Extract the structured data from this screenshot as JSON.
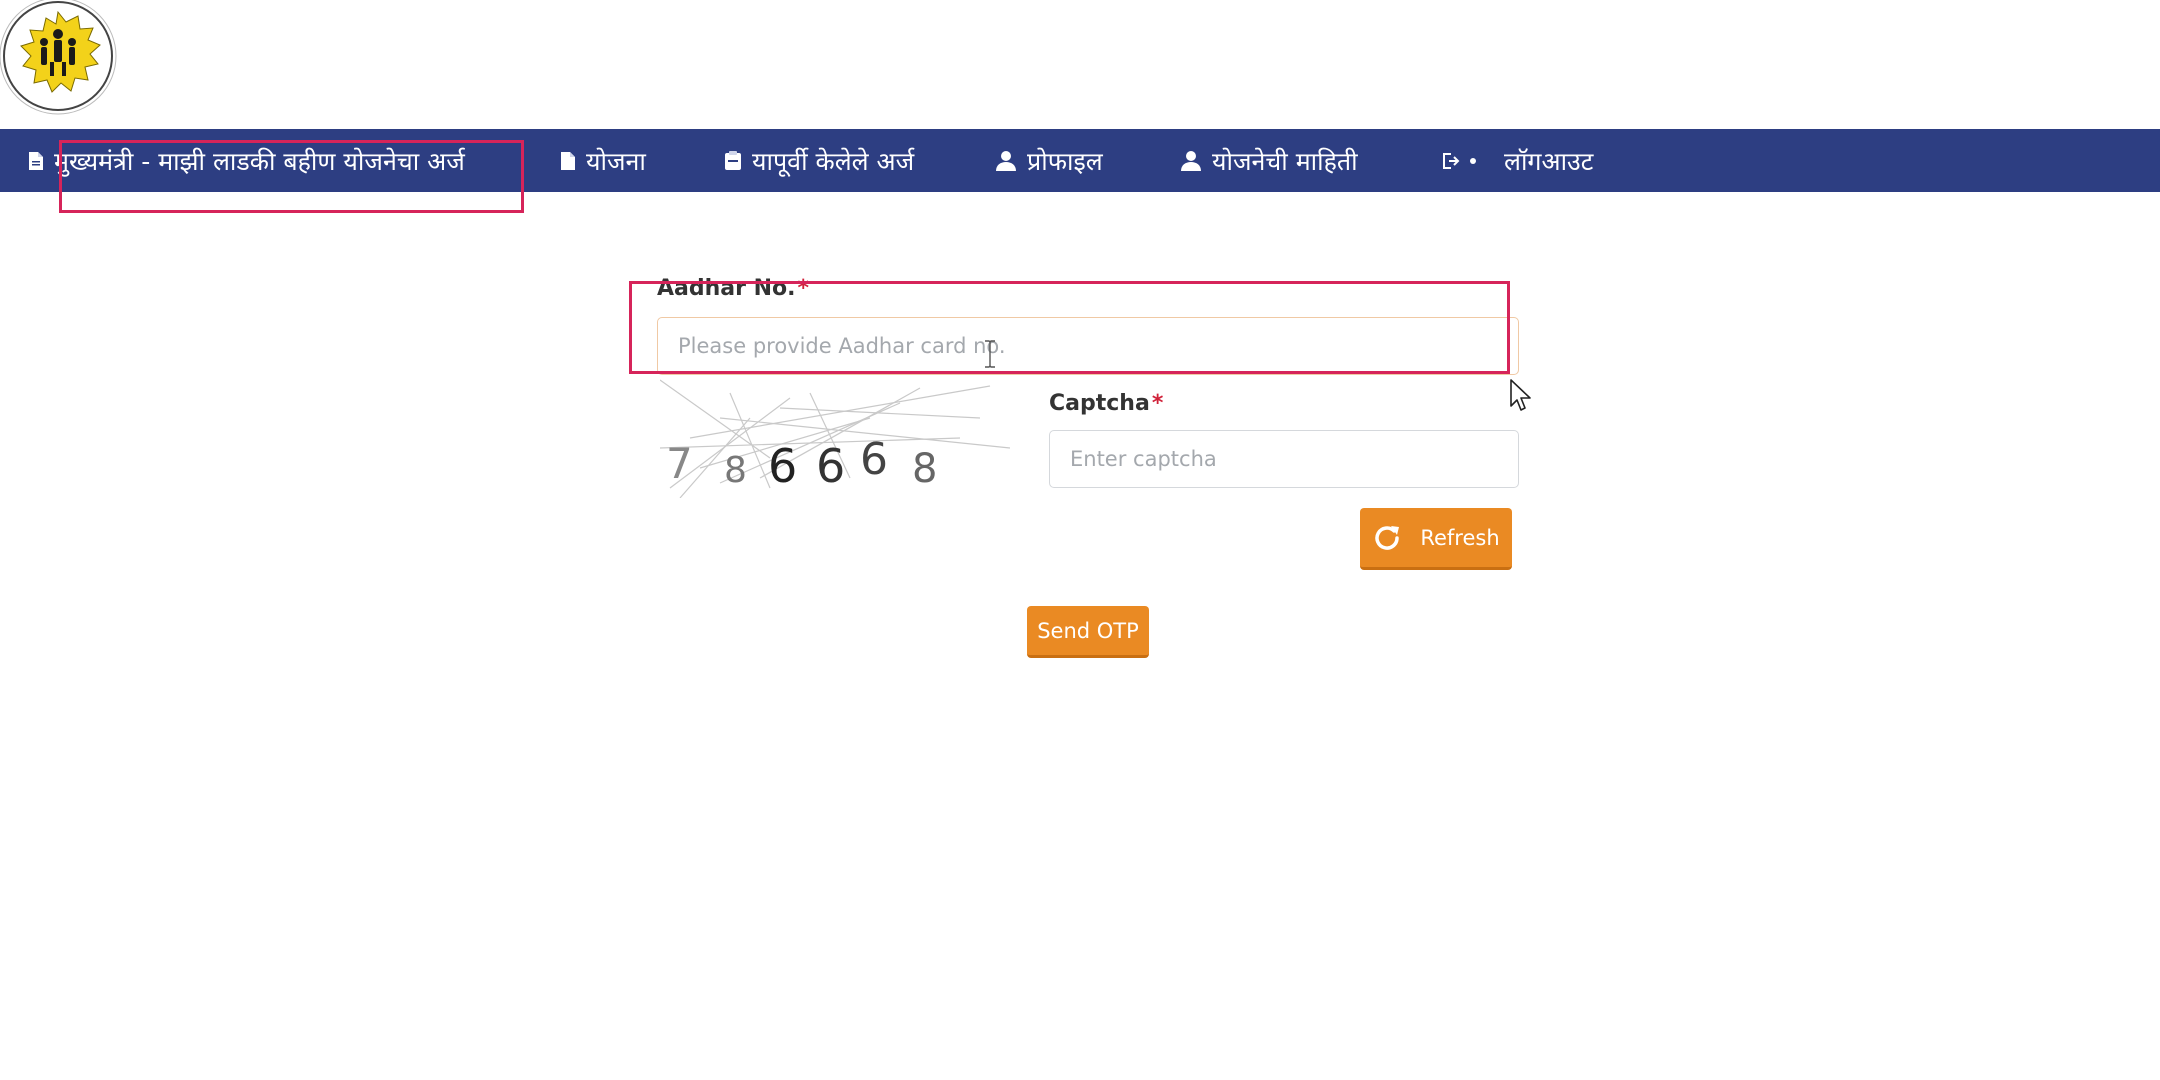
{
  "nav": {
    "items": [
      {
        "label": "मुख्यमंत्री - माझी लाडकी बहीण योजनेचा अर्ज",
        "icon": "document-icon"
      },
      {
        "label": "योजना",
        "icon": "document-icon"
      },
      {
        "label": "यापूर्वी केलेले अर्ज",
        "icon": "clipboard-icon"
      },
      {
        "label": "प्रोफाइल",
        "icon": "user-icon"
      },
      {
        "label": "योजनेची माहिती",
        "icon": "user-icon"
      },
      {
        "label": "लॉगआउट",
        "icon": "logout-icon"
      }
    ]
  },
  "form": {
    "aadhar_label": "Aadhar No.",
    "aadhar_placeholder": "Please provide Aadhar card no.",
    "captcha_label": "Captcha",
    "captcha_placeholder": "Enter captcha",
    "required_mark": "*",
    "captcha_value": "786668",
    "refresh_label": "Refresh",
    "send_otp_label": "Send OTP"
  },
  "colors": {
    "navbar": "#2d3e82",
    "button": "#ea8a23",
    "highlight": "#d6245a",
    "required": "#d0223a"
  }
}
